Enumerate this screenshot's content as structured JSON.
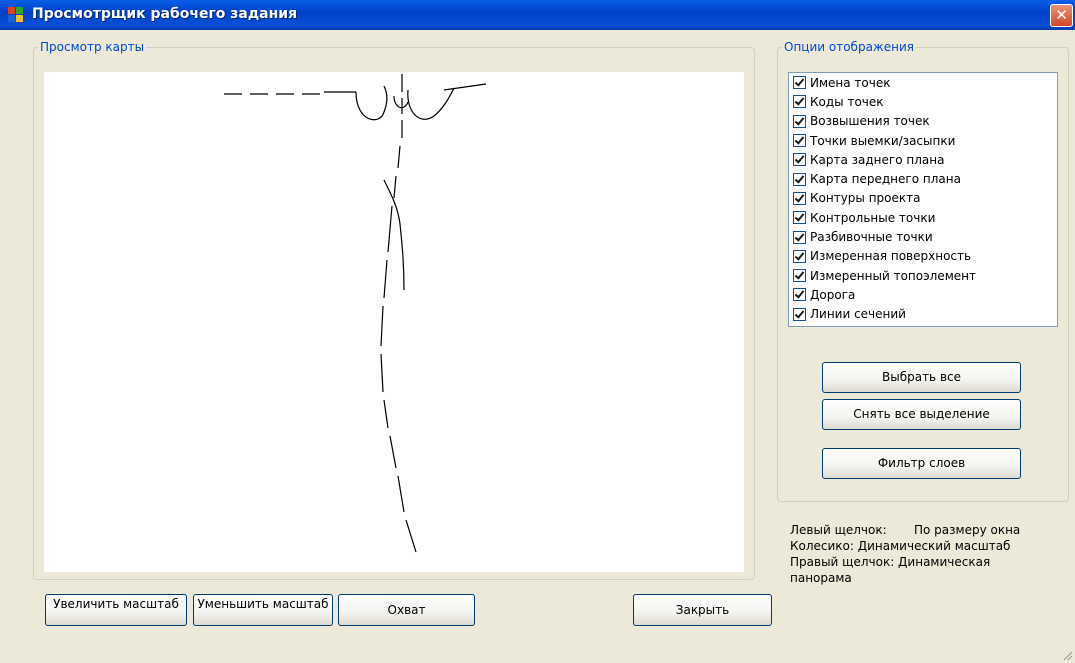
{
  "window": {
    "title": "Просмотрщик рабочего задания",
    "close_glyph": "✕",
    "icon": "app-window-icon"
  },
  "map_group": {
    "legend": "Просмотр карты"
  },
  "options_group": {
    "legend": "Опции отображения",
    "items": [
      {
        "label": "Имена точек",
        "checked": true
      },
      {
        "label": "Коды точек",
        "checked": true
      },
      {
        "label": "Возвышения точек",
        "checked": true
      },
      {
        "label": "Точки выемки/засыпки",
        "checked": true
      },
      {
        "label": "Карта заднего плана",
        "checked": true
      },
      {
        "label": "Карта переднего плана",
        "checked": true
      },
      {
        "label": "Контуры проекта",
        "checked": true
      },
      {
        "label": "Контрольные точки",
        "checked": true
      },
      {
        "label": "Разбивочные точки",
        "checked": true
      },
      {
        "label": "Измеренная поверхность",
        "checked": true
      },
      {
        "label": "Измеренный топоэлемент",
        "checked": true
      },
      {
        "label": "Дорога",
        "checked": true
      },
      {
        "label": "Линии сечений",
        "checked": true
      }
    ],
    "select_all": "Выбрать все",
    "deselect_all": "Снять все выделение",
    "layer_filter": "Фильтр слоев"
  },
  "help": {
    "left_click_label": "Левый щелчок:",
    "left_click_value": "По размеру окна",
    "wheel": "Колесико: Динамический масштаб",
    "right_click_line1": "Правый щелчок: Динамическая",
    "right_click_line2": "панорама"
  },
  "bottom_buttons": {
    "zoom_in": "Увеличить масштаб",
    "zoom_out": "Уменьшить масштаб",
    "extent": "Охват",
    "close": "Закрыть"
  },
  "colors": {
    "titlebar": "#0a4fd6",
    "legend": "#0046d5",
    "face": "#ece9d8",
    "button_border": "#003c74"
  }
}
